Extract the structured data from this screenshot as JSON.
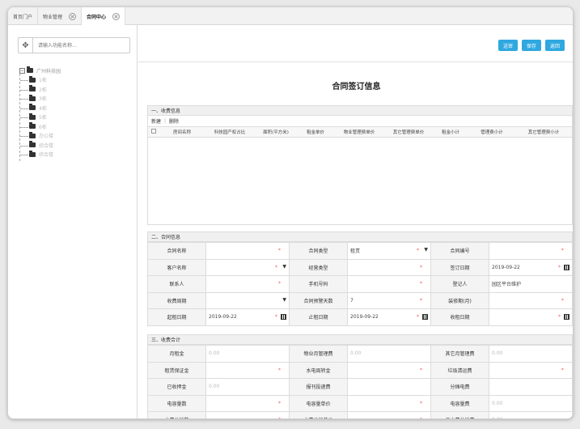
{
  "tabs": [
    {
      "label": "首页门户",
      "active": false,
      "closable": false
    },
    {
      "label": "物业管理",
      "active": false,
      "closable": true
    },
    {
      "label": "合同中心",
      "active": true,
      "closable": true
    }
  ],
  "sidebar": {
    "search_placeholder": "请输入功能名称...",
    "root": "广州科技园",
    "items": [
      "1栋",
      "2栋",
      "3栋",
      "4栋",
      "5栋",
      "6栋",
      "办公楼",
      "综合楼",
      "综合楼"
    ]
  },
  "toolbar": {
    "submit": "送审",
    "save": "保存",
    "back": "返回"
  },
  "form_title": "合同签订信息",
  "section1": {
    "title": "一、收费信息",
    "add": "新建",
    "delete": "删除",
    "columns": [
      "房间名称",
      "科技园产权占比",
      "面积(平方米)",
      "租金单价",
      "物业管理费单价",
      "其它管理费单价",
      "租金小计",
      "管理费小计",
      "其它管理费小计"
    ]
  },
  "section2": {
    "title": "二、合同信息",
    "rows": [
      [
        {
          "label": "合同名称",
          "value": "",
          "req": true
        },
        {
          "label": "合同类型",
          "value": "租赁",
          "req": true,
          "dd": true
        },
        {
          "label": "合同编号",
          "value": "",
          "req": true
        }
      ],
      [
        {
          "label": "客户名称",
          "value": "",
          "req": true,
          "dd": true
        },
        {
          "label": "经营类型",
          "value": "",
          "req": true
        },
        {
          "label": "签订日期",
          "value": "2019-09-22",
          "req": true,
          "cal": true
        }
      ],
      [
        {
          "label": "联系人",
          "value": "",
          "req": true
        },
        {
          "label": "手机号码",
          "value": "",
          "req": true
        },
        {
          "label": "登记人",
          "value": "园区平台维护",
          "req": false
        }
      ],
      [
        {
          "label": "收费周期",
          "value": "",
          "req": false,
          "dd": true
        },
        {
          "label": "合同预警天数",
          "value": "7",
          "req": true
        },
        {
          "label": "装修期(月)",
          "value": "",
          "req": true
        }
      ],
      [
        {
          "label": "起租日期",
          "value": "2019-09-22",
          "req": true,
          "cal": true
        },
        {
          "label": "止租日期",
          "value": "2019-09-22",
          "req": true,
          "cal": true
        },
        {
          "label": "收租日期",
          "value": "",
          "req": true,
          "cal": true
        }
      ]
    ]
  },
  "section3": {
    "title": "三、收费合计",
    "rows": [
      [
        {
          "label": "月租金",
          "value": "0.00",
          "gray": true
        },
        {
          "label": "物业月管理费",
          "value": "0.00",
          "gray": true
        },
        {
          "label": "其它月管理费",
          "value": "0.00",
          "gray": true
        }
      ],
      [
        {
          "label": "租赁保证金",
          "value": "",
          "req": true
        },
        {
          "label": "水电周转金",
          "value": "",
          "req": true
        },
        {
          "label": "垃圾清运费",
          "value": "",
          "req": true
        }
      ],
      [
        {
          "label": "已收押金",
          "value": "0.00",
          "gray": true
        },
        {
          "label": "报刊投递费",
          "value": "",
          "req": false
        },
        {
          "label": "分摊电费",
          "value": "",
          "req": false
        }
      ],
      [
        {
          "label": "电容量数",
          "value": "",
          "req": true
        },
        {
          "label": "电容量单价",
          "value": "",
          "req": true
        },
        {
          "label": "电容量费",
          "value": "0.00",
          "gray": true
        }
      ],
      [
        {
          "label": "水费分摊数",
          "value": "",
          "req": true
        },
        {
          "label": "水费分摊单价",
          "value": "",
          "req": true
        },
        {
          "label": "月水费分摊费",
          "value": "0.00",
          "gray": true
        }
      ]
    ]
  }
}
